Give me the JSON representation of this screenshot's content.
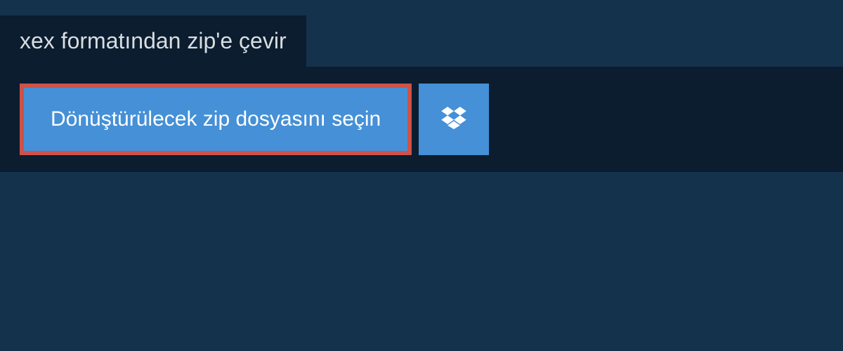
{
  "header": {
    "title": "xex formatından zip'e çevir"
  },
  "content": {
    "select_file_label": "Dönüştürülecek zip dosyasını seçin"
  },
  "colors": {
    "bg_outer": "#15324c",
    "bg_panel": "#0b1d2e",
    "button_bg": "#4590d6",
    "button_border": "#cf5149",
    "text_light": "#d8dde2",
    "text_white": "#ffffff"
  }
}
